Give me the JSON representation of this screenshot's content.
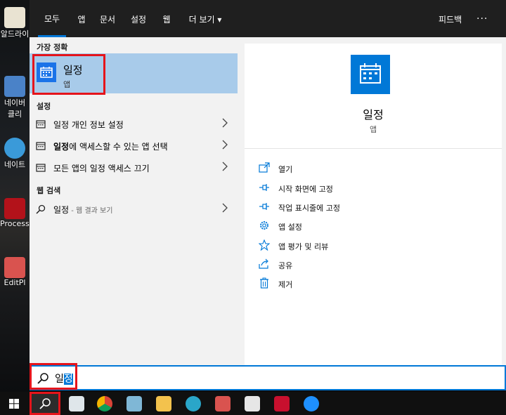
{
  "desktop": {
    "icons": [
      {
        "label": "알드라이",
        "icon": "aldrive-icon"
      },
      {
        "label": "네이버",
        "icon": "naver-cleaner-icon"
      },
      {
        "label": "클리",
        "icon": "naver-cleaner-icon"
      },
      {
        "label": "네이트",
        "icon": "nate-icon"
      },
      {
        "label": "ProcessC",
        "icon": "process-icon"
      },
      {
        "label": "EditPl",
        "icon": "editplus-icon"
      }
    ]
  },
  "tabs": [
    {
      "label": "모두",
      "active": true
    },
    {
      "label": "앱"
    },
    {
      "label": "문서"
    },
    {
      "label": "설정"
    },
    {
      "label": "웹"
    },
    {
      "label": "더 보기 ▾"
    }
  ],
  "top_right": {
    "feedback": "피드백",
    "more": "···"
  },
  "best_match": {
    "heading": "가장 정확",
    "title": "일정",
    "subtitle": "앱",
    "icon": "calendar-icon"
  },
  "settings": {
    "heading": "설정",
    "items": [
      {
        "label": "일정 개인 정보 설정",
        "icon": "settings-page-icon"
      },
      {
        "label_bold": "일정",
        "label_rest": "에 액세스할 수 있는 앱 선택",
        "icon": "settings-page-icon"
      },
      {
        "label": "모든 앱의 일정 액세스 끄기",
        "icon": "settings-page-icon"
      }
    ]
  },
  "web_search": {
    "heading": "웹 검색",
    "item": {
      "label": "일정",
      "suffix": " - 웹 결과 보기",
      "icon": "search-icon"
    }
  },
  "preview": {
    "name": "일정",
    "type": "앱",
    "actions": [
      {
        "label": "열기",
        "icon": "open-icon"
      },
      {
        "label": "시작 화면에 고정",
        "icon": "pin-icon"
      },
      {
        "label": "작업 표시줄에 고정",
        "icon": "pin-icon"
      },
      {
        "label": "앱 설정",
        "icon": "gear-icon"
      },
      {
        "label": "앱 평가 및 리뷰",
        "icon": "star-icon"
      },
      {
        "label": "공유",
        "icon": "share-icon"
      },
      {
        "label": "제거",
        "icon": "trash-icon"
      }
    ]
  },
  "search": {
    "query_pre": "일",
    "query_sel": "정"
  },
  "colors": {
    "accent": "#0078d7",
    "highlight": "#a8cbea",
    "annotation_red": "#e5141b",
    "topbar": "#1f1f1f"
  }
}
